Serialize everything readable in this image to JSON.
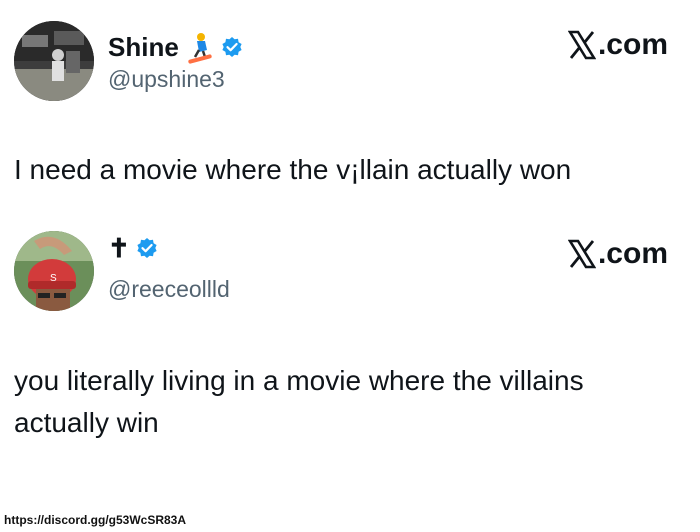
{
  "tweets": [
    {
      "name": "Shine",
      "handle": "@upshine3",
      "source": ".com",
      "text": "I need a movie where the v¡llain actually won",
      "verified": true,
      "emoji": "snowboarder-icon"
    },
    {
      "name": "✝",
      "handle": "@reeceollld",
      "source": ".com",
      "text": "you literally living in a movie where the villains actually win",
      "verified": true
    }
  ],
  "footer": {
    "link": "https://discord.gg/g53WcSR83A"
  },
  "colors": {
    "verified": "#1d9bf0",
    "handle": "#536471",
    "text": "#0f1419"
  }
}
